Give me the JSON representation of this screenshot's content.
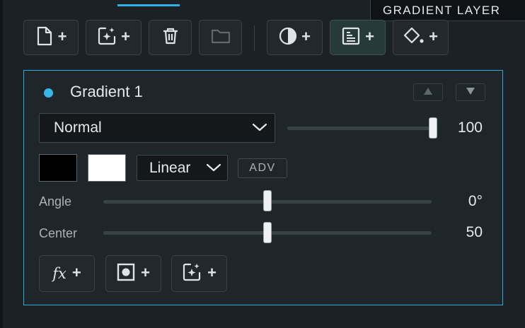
{
  "tooltip": {
    "text": "GRADIENT LAYER"
  },
  "toolbar": {
    "plus_label": "+",
    "buttons": [
      {
        "name": "new-layer-button",
        "icon": "new-document-icon",
        "enabled": true
      },
      {
        "name": "new-ai-layer-button",
        "icon": "sparkle-frame-icon",
        "enabled": true
      },
      {
        "name": "delete-layer-button",
        "icon": "trash-icon",
        "enabled": true
      },
      {
        "name": "open-folder-button",
        "icon": "folder-icon",
        "enabled": false
      },
      {
        "name": "add-adjustment-button",
        "icon": "half-circle-contrast-icon",
        "enabled": true
      },
      {
        "name": "add-gradient-layer-button",
        "icon": "gradient-layer-icon",
        "enabled": true,
        "active": true
      },
      {
        "name": "add-fill-layer-button",
        "icon": "paint-bucket-icon",
        "enabled": true
      }
    ]
  },
  "layer": {
    "name": "Gradient 1",
    "status_color": "#38b6ea",
    "move_up_icon": "triangle-up-icon",
    "move_down_icon": "triangle-down-icon",
    "blend_mode": "Normal",
    "opacity": 100,
    "colors": {
      "start": "#000000",
      "end": "#ffffff"
    },
    "gradient_type": "Linear",
    "adv_label": "ADV",
    "params": [
      {
        "label": "Angle",
        "value": "0°",
        "fraction": 0.5
      },
      {
        "label": "Center",
        "value": "50",
        "fraction": 0.5
      }
    ]
  },
  "bottom_buttons": [
    {
      "name": "add-effect-button",
      "label": "fx",
      "icon": "fx-icon"
    },
    {
      "name": "add-mask-button",
      "icon": "mask-icon"
    },
    {
      "name": "add-ai-button",
      "icon": "sparkle-frame-icon"
    }
  ],
  "accent_color": "#2ea9dd"
}
